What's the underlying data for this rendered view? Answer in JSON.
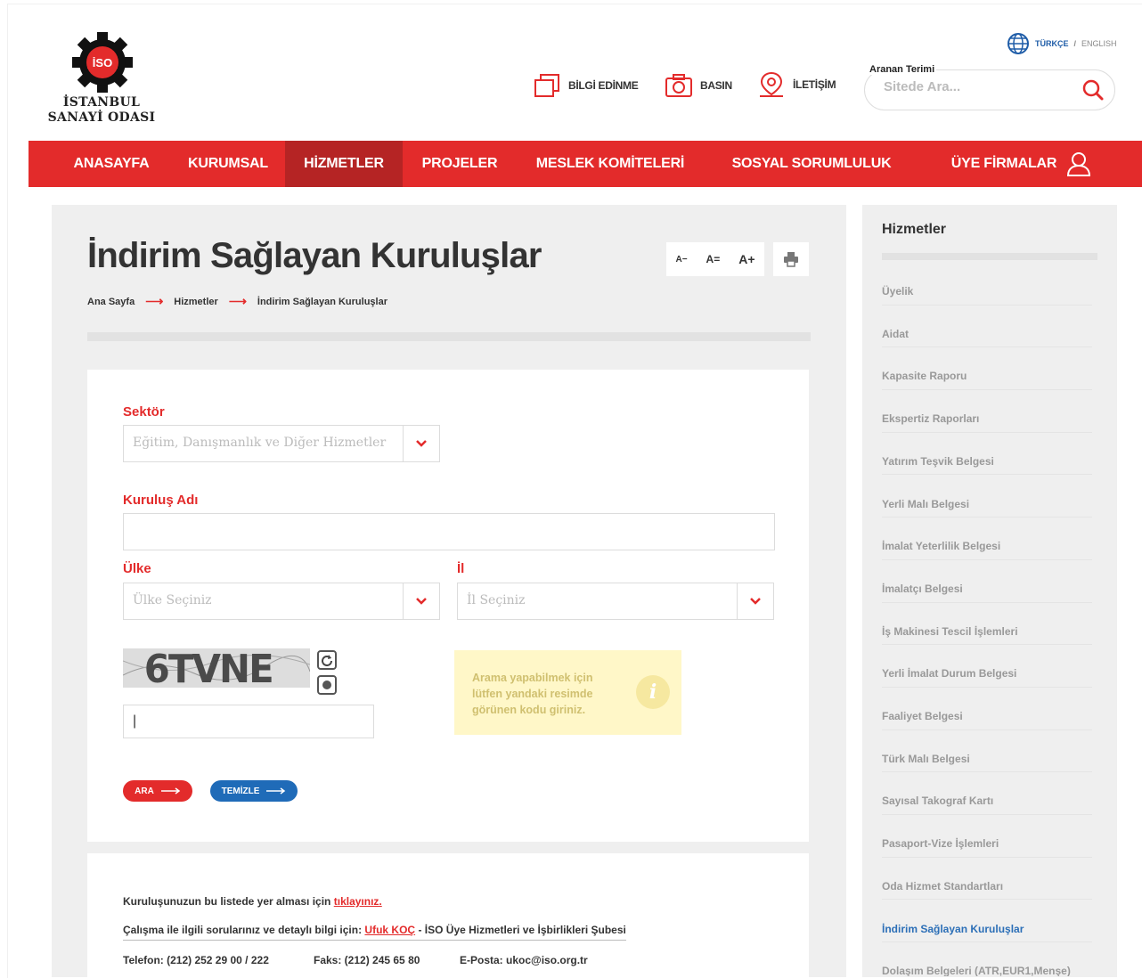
{
  "brand": {
    "logo_text": "İSO",
    "name_line1": "İSTANBUL",
    "name_line2": "SANAYİ ODASI",
    "primary_color": "#e32b2b"
  },
  "header": {
    "links": [
      {
        "label": "BİLGİ EDİNME",
        "icon": "documents-icon"
      },
      {
        "label": "BASIN",
        "icon": "camera-icon"
      },
      {
        "label": "İLETİŞİM",
        "icon": "location-pin-icon"
      }
    ],
    "lang": {
      "tr": "TÜRKÇE",
      "sep": "/",
      "en": "ENGLISH"
    },
    "search": {
      "label": "Aranan Terimi",
      "placeholder": "Sitede Ara..."
    }
  },
  "nav": {
    "items": [
      {
        "label": "ANASAYFA"
      },
      {
        "label": "KURUMSAL"
      },
      {
        "label": "HİZMETLER",
        "active": true
      },
      {
        "label": "PROJELER"
      },
      {
        "label": "MESLEK KOMİTELERİ"
      },
      {
        "label": "SOSYAL SORUMLULUK"
      },
      {
        "label": "ÜYE FİRMALAR"
      }
    ]
  },
  "page": {
    "title": "İndirim Sağlayan Kuruluşlar",
    "font_tools": {
      "decrease": "A−",
      "reset": "A=",
      "increase": "A+"
    },
    "breadcrumb": [
      "Ana Sayfa",
      "Hizmetler",
      "İndirim Sağlayan Kuruluşlar"
    ]
  },
  "form": {
    "sektor": {
      "label": "Sektör",
      "value": "Eğitim, Danışmanlık ve Diğer Hizmetler"
    },
    "kurulus": {
      "label": "Kuruluş Adı",
      "value": ""
    },
    "ulke": {
      "label": "Ülke",
      "value": "Ülke Seçiniz"
    },
    "il": {
      "label": "İl",
      "value": "İl Seçiniz"
    },
    "captcha": {
      "code": "6TVNE",
      "input_value": "|"
    },
    "hint": "Arama yapabilmek için lütfen yandaki resimde görünen kodu giriniz.",
    "search_button": "ARA",
    "clear_button": "TEMİZLE"
  },
  "info": {
    "line1_text": "Kuruluşunuzun bu listede yer alması için",
    "line1_link": "tıklayınız.",
    "line2_text": "Çalışma ile ilgili sorularınız ve detaylı bilgi için:",
    "line2_link": "Ufuk KOÇ",
    "line2_rest": "- İSO Üye Hizmetleri ve İşbirlikleri Şubesi",
    "phone": "Telefon: (212) 252 29 00 / 222",
    "fax": "Faks: (212) 245 65 80",
    "email": "E-Posta: ukoc@iso.org.tr"
  },
  "sidebar": {
    "title": "Hizmetler",
    "items": [
      {
        "label": "Üyelik"
      },
      {
        "label": "Aidat"
      },
      {
        "label": "Kapasite Raporu"
      },
      {
        "label": "Ekspertiz Raporları"
      },
      {
        "label": "Yatırım Teşvik Belgesi"
      },
      {
        "label": "Yerli Malı Belgesi"
      },
      {
        "label": "İmalat Yeterlilik Belgesi"
      },
      {
        "label": "İmalatçı Belgesi"
      },
      {
        "label": "İş Makinesi Tescil İşlemleri"
      },
      {
        "label": "Yerli İmalat Durum Belgesi"
      },
      {
        "label": "Faaliyet Belgesi"
      },
      {
        "label": "Türk Malı Belgesi"
      },
      {
        "label": "Sayısal Takograf Kartı"
      },
      {
        "label": "Pasaport-Vize İşlemleri"
      },
      {
        "label": "Oda Hizmet Standartları"
      },
      {
        "label": "İndirim Sağlayan Kuruluşlar",
        "active": true
      },
      {
        "label": "Dolaşım Belgeleri (ATR,EUR1,Menşe)"
      }
    ]
  }
}
